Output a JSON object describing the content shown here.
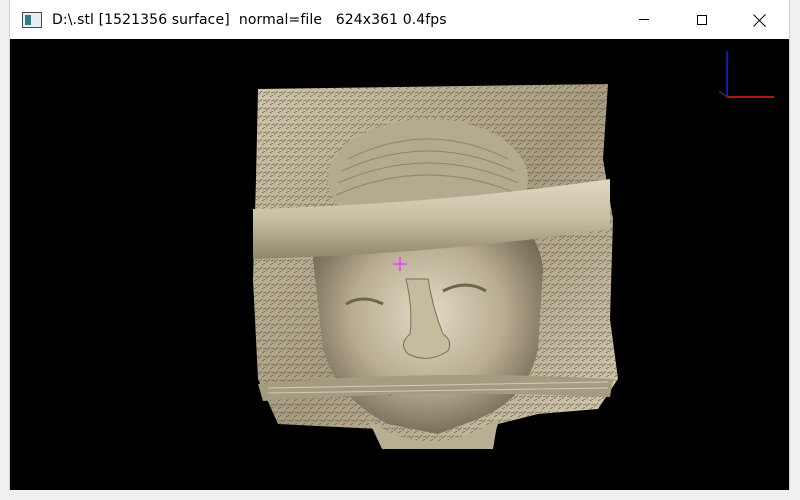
{
  "window": {
    "title": "D:\\.stl [1521356 surface]  normal=file   624x361 0.4fps",
    "icon": "app-window-icon",
    "controls": [
      "minimize-icon",
      "maximize-icon",
      "close-icon"
    ]
  },
  "viewport": {
    "background": "#000000",
    "surface_color": "#c9bfa3",
    "cursor_color": "#ff33ff",
    "axes_colors": {
      "x": "#e02020",
      "y": "#2020e0"
    }
  }
}
